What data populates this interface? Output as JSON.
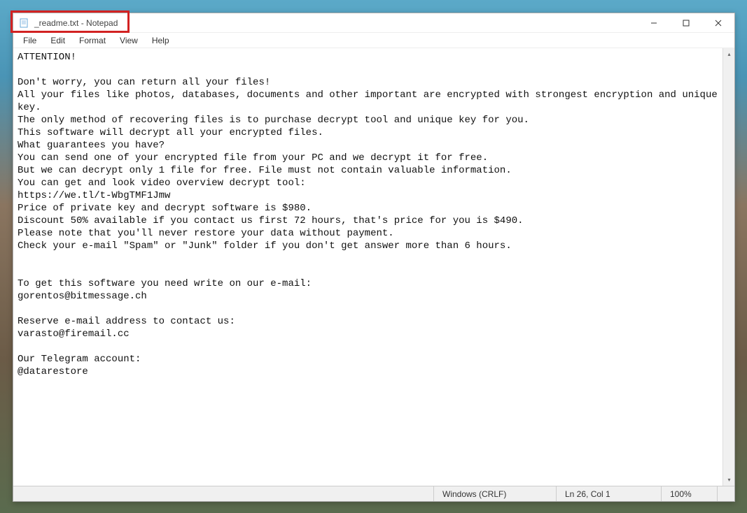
{
  "window": {
    "title": "_readme.txt - Notepad"
  },
  "menubar": {
    "file": "File",
    "edit": "Edit",
    "format": "Format",
    "view": "View",
    "help": "Help"
  },
  "editor": {
    "content": "ATTENTION!\n\nDon't worry, you can return all your files!\nAll your files like photos, databases, documents and other important are encrypted with strongest encryption and unique key.\nThe only method of recovering files is to purchase decrypt tool and unique key for you.\nThis software will decrypt all your encrypted files.\nWhat guarantees you have?\nYou can send one of your encrypted file from your PC and we decrypt it for free.\nBut we can decrypt only 1 file for free. File must not contain valuable information.\nYou can get and look video overview decrypt tool:\nhttps://we.tl/t-WbgTMF1Jmw\nPrice of private key and decrypt software is $980.\nDiscount 50% available if you contact us first 72 hours, that's price for you is $490.\nPlease note that you'll never restore your data without payment.\nCheck your e-mail \"Spam\" or \"Junk\" folder if you don't get answer more than 6 hours.\n\n\nTo get this software you need write on our e-mail:\ngorentos@bitmessage.ch\n\nReserve e-mail address to contact us:\nvarasto@firemail.cc\n\nOur Telegram account:\n@datarestore"
  },
  "statusbar": {
    "encoding": "Windows (CRLF)",
    "position": "Ln 26, Col 1",
    "zoom": "100%"
  }
}
